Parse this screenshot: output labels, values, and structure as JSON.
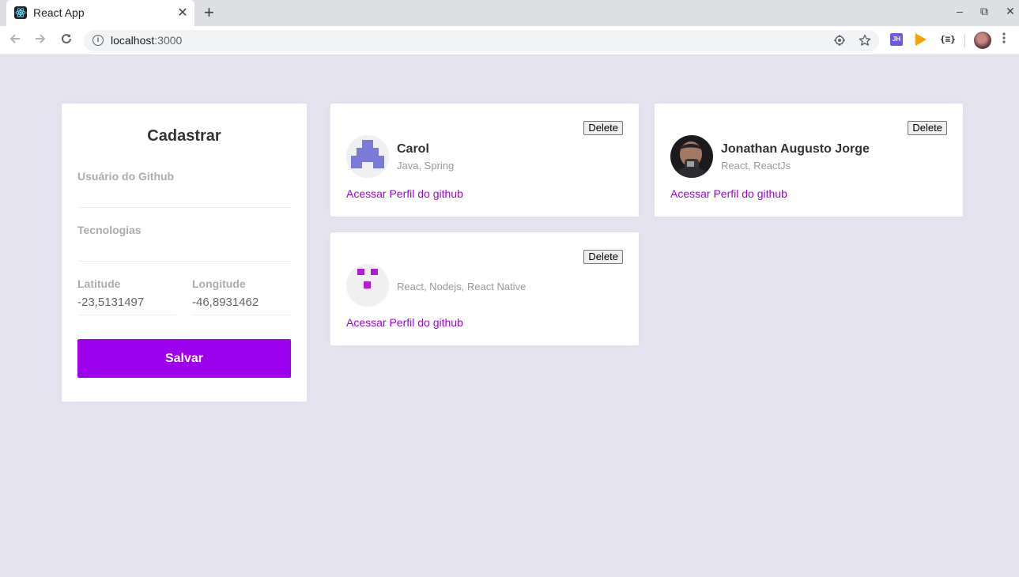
{
  "browser": {
    "tab_title": "React App",
    "tab_close": "✕",
    "new_tab": "+",
    "url_host": "localhost",
    "url_port": ":3000",
    "window_controls": {
      "minimize": "–",
      "restore": "⧉",
      "close": "✕"
    },
    "extensions": {
      "jh_label": "JH",
      "json_label": "{≡}"
    }
  },
  "form": {
    "title": "Cadastrar",
    "github_user_label": "Usuário do Github",
    "github_user_value": "",
    "techs_label": "Tecnologias",
    "techs_value": "",
    "latitude_label": "Latitude",
    "latitude_value": "-23,5131497",
    "longitude_label": "Longitude",
    "longitude_value": "-46,8931462",
    "submit_label": "Salvar"
  },
  "devs": [
    {
      "name": "Carol",
      "techs": "Java, Spring",
      "delete_label": "Delete",
      "profile_link": "Acessar Perfil do github"
    },
    {
      "name": "Jonathan Augusto Jorge",
      "techs": "React, ReactJs",
      "delete_label": "Delete",
      "profile_link": "Acessar Perfil do github"
    },
    {
      "name": "",
      "techs": "React, Nodejs, React Native",
      "delete_label": "Delete",
      "profile_link": "Acessar Perfil do github"
    }
  ],
  "colors": {
    "background": "#e5e3ef",
    "accent": "#9c00ec",
    "identicon_carol": "#7b7bd6",
    "identicon_third": "#b21ecf"
  }
}
